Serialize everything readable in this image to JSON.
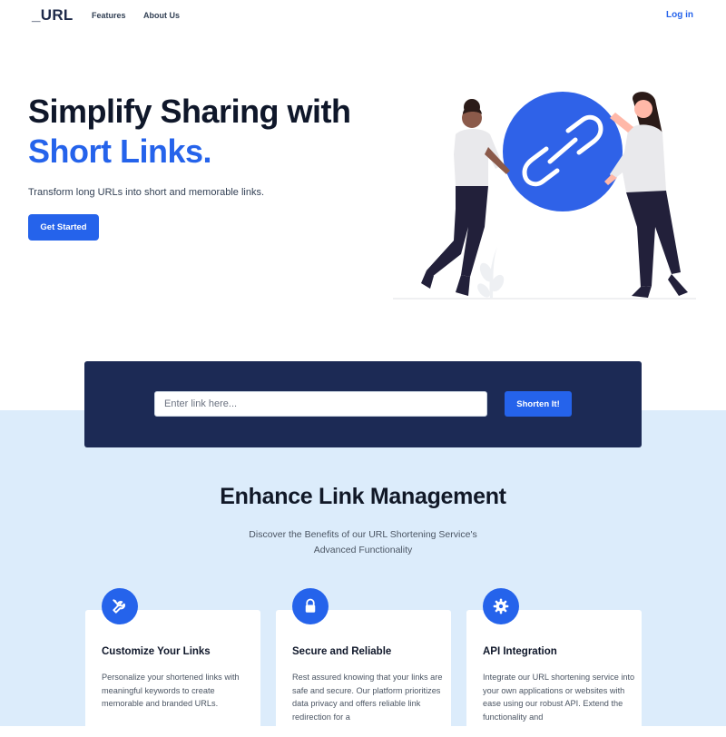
{
  "nav": {
    "logo": "_URL",
    "features": "Features",
    "about": "About Us",
    "login": "Log in"
  },
  "hero": {
    "title_line1": "Simplify Sharing with",
    "title_line2": "Short Links.",
    "subtitle": "Transform long URLs into short and memorable links.",
    "cta": "Get Started"
  },
  "shortener": {
    "placeholder": "Enter link here...",
    "value": "",
    "button": "Shorten It!"
  },
  "features": {
    "title": "Enhance Link Management",
    "subtitle": "Discover the Benefits of our URL Shortening Service's Advanced Functionality",
    "cards": [
      {
        "icon": "wrench-screwdriver-icon",
        "title": "Customize Your Links",
        "text": "Personalize your shortened links with meaningful keywords to create memorable and branded URLs."
      },
      {
        "icon": "lock-icon",
        "title": "Secure and Reliable",
        "text": "Rest assured knowing that your links are safe and secure. Our platform prioritizes data privacy and offers reliable link redirection for a"
      },
      {
        "icon": "gear-icon",
        "title": "API Integration",
        "text": "Integrate our URL shortening service into your own applications or websites with ease using our robust API. Extend the functionality and"
      }
    ]
  },
  "colors": {
    "accent": "#2563eb",
    "panel": "#1c2a55",
    "section_bg": "#dcecfb",
    "text_dark": "#0f172a"
  }
}
